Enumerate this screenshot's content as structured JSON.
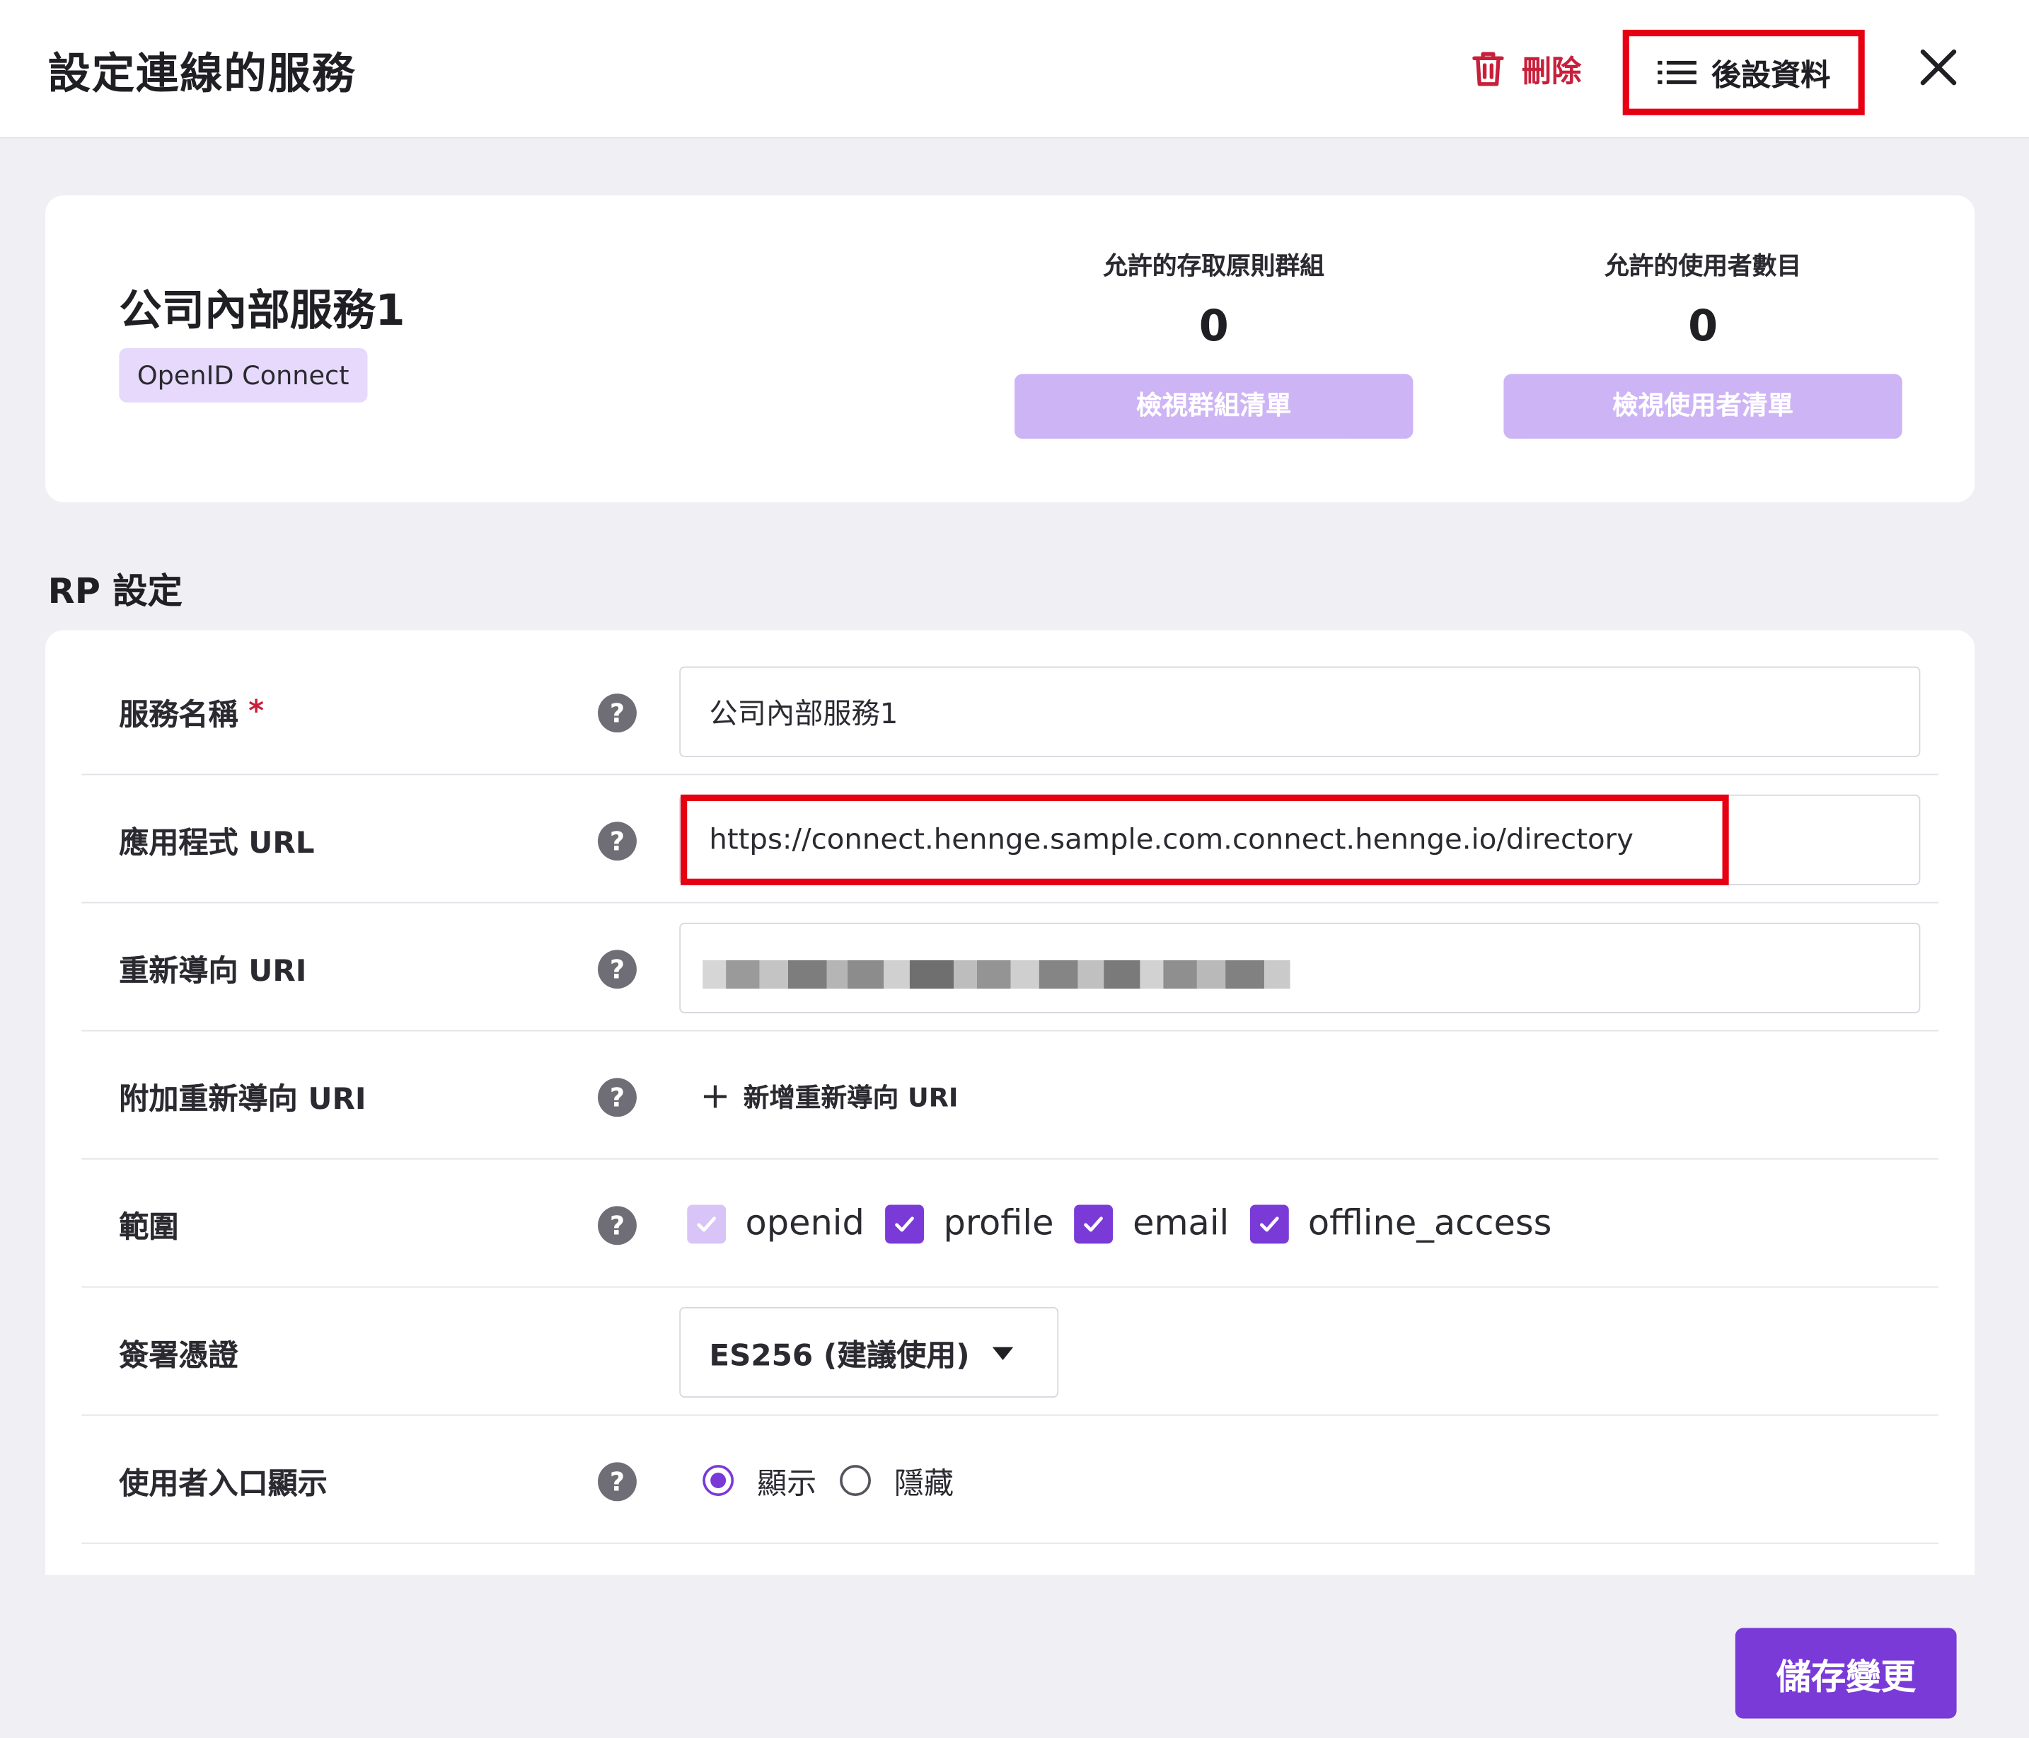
{
  "header": {
    "title": "設定連線的服務",
    "delete_label": "刪除",
    "later_label": "後設資料"
  },
  "summary": {
    "service_name": "公司內部服務1",
    "protocol": "OpenID Connect",
    "groups": {
      "label": "允許的存取原則群組",
      "value": "0",
      "button": "檢視群組清單"
    },
    "users": {
      "label": "允許的使用者數目",
      "value": "0",
      "button": "檢視使用者清單"
    }
  },
  "rp": {
    "section_title": "RP 設定",
    "service_name_label": "服務名稱",
    "required_mark": "*",
    "service_name_value": "公司內部服務1",
    "app_url_label": "應用程式 URL",
    "app_url_value": "https://connect.hennge.sample.com.connect.hennge.io/directory",
    "redirect_label": "重新導向 URI",
    "extra_redirect_label": "附加重新導向 URI",
    "add_redirect": "新增重新導向 URI",
    "scope_label": "範圍",
    "scopes": [
      "openid",
      "profile",
      "email",
      "offline_access"
    ],
    "signing_label": "簽署憑證",
    "signing_value": "ES256 (建議使用)",
    "portal_label": "使用者入口顯示",
    "portal_options": [
      "顯示",
      "隱藏"
    ],
    "help_glyph": "?"
  },
  "footer": {
    "save_label": "儲存變更"
  },
  "colors": {
    "accent": "#7a3ad8",
    "danger": "#c8203b",
    "highlight": "#e60012"
  }
}
